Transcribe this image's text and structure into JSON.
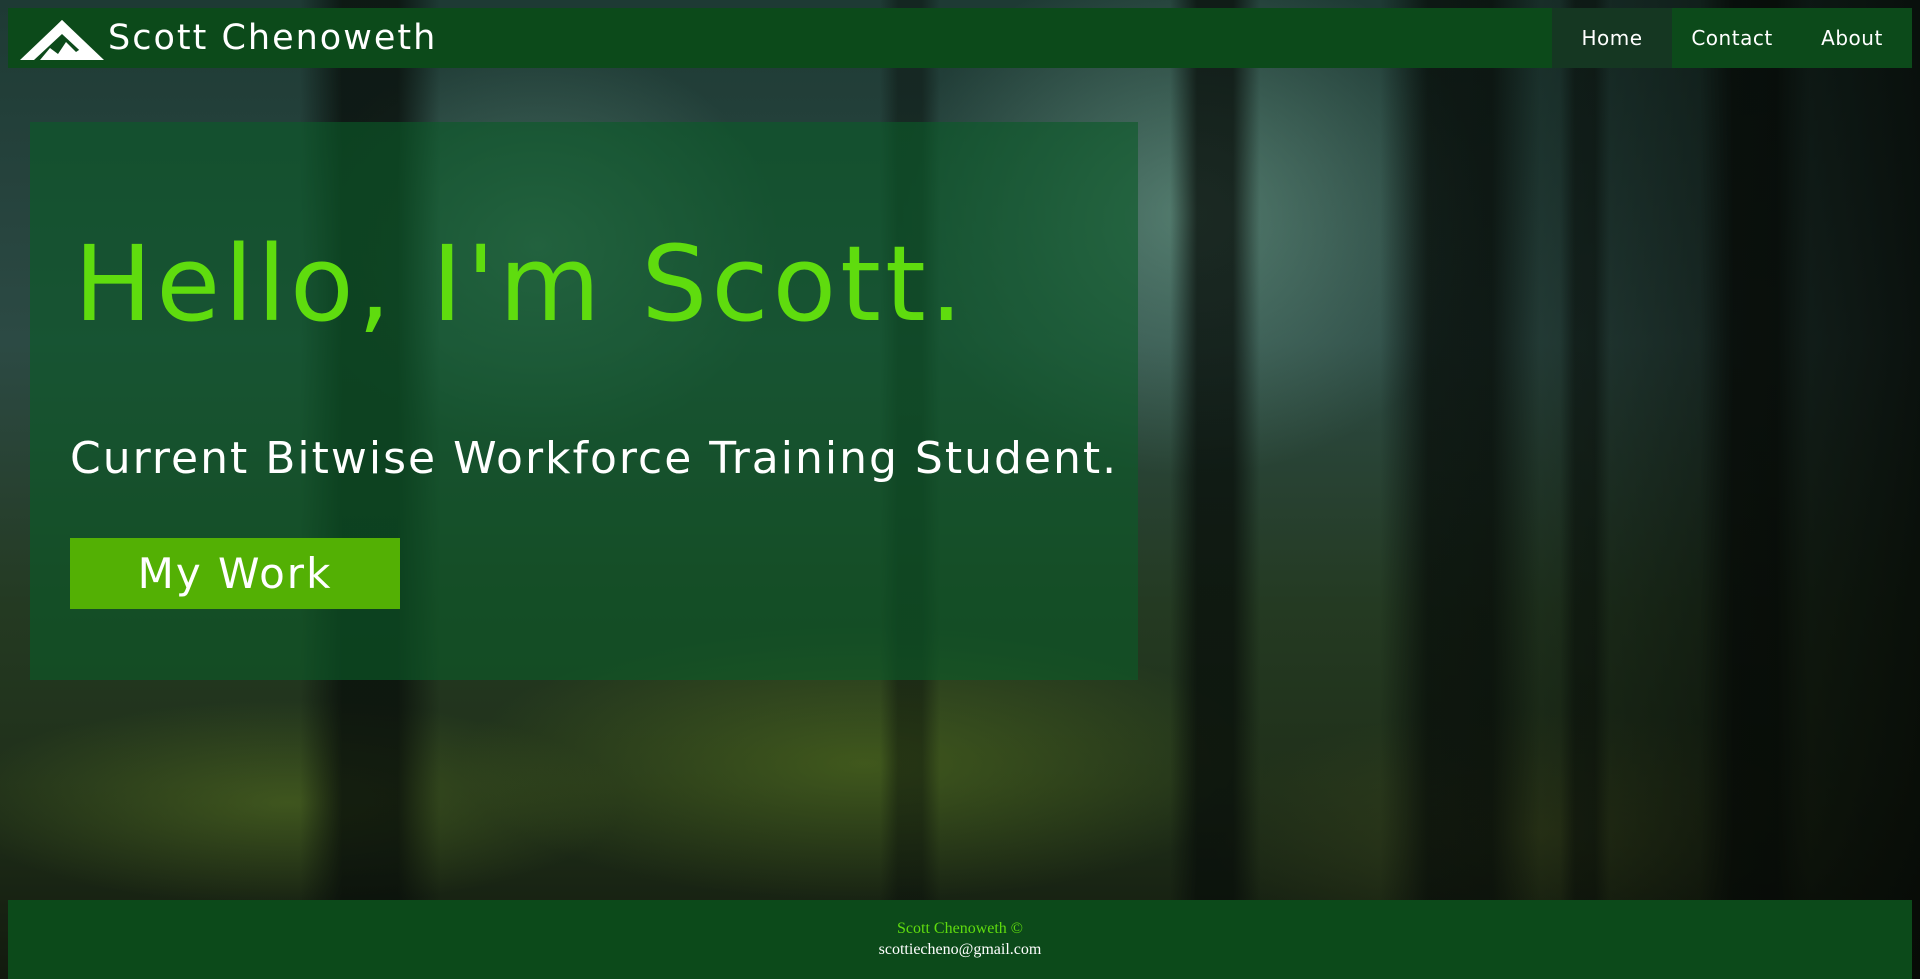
{
  "header": {
    "brand_name": "Scott Chenoweth",
    "logo_icon": "mountain-icon",
    "nav": [
      {
        "label": "Home",
        "active": true
      },
      {
        "label": "Contact",
        "active": false
      },
      {
        "label": "About",
        "active": false
      }
    ]
  },
  "hero": {
    "title": "Hello, I'm Scott.",
    "subtitle": "Current Bitwise Workforce Training Student.",
    "button_label": "My Work"
  },
  "footer": {
    "name": "Scott Chenoweth ©",
    "email": "scottiecheno@gmail.com"
  },
  "colors": {
    "header_bg": "#0c4a1a",
    "accent_green": "#5fdc0e",
    "button_bg": "#53b004",
    "active_nav_bg": "#153722"
  }
}
